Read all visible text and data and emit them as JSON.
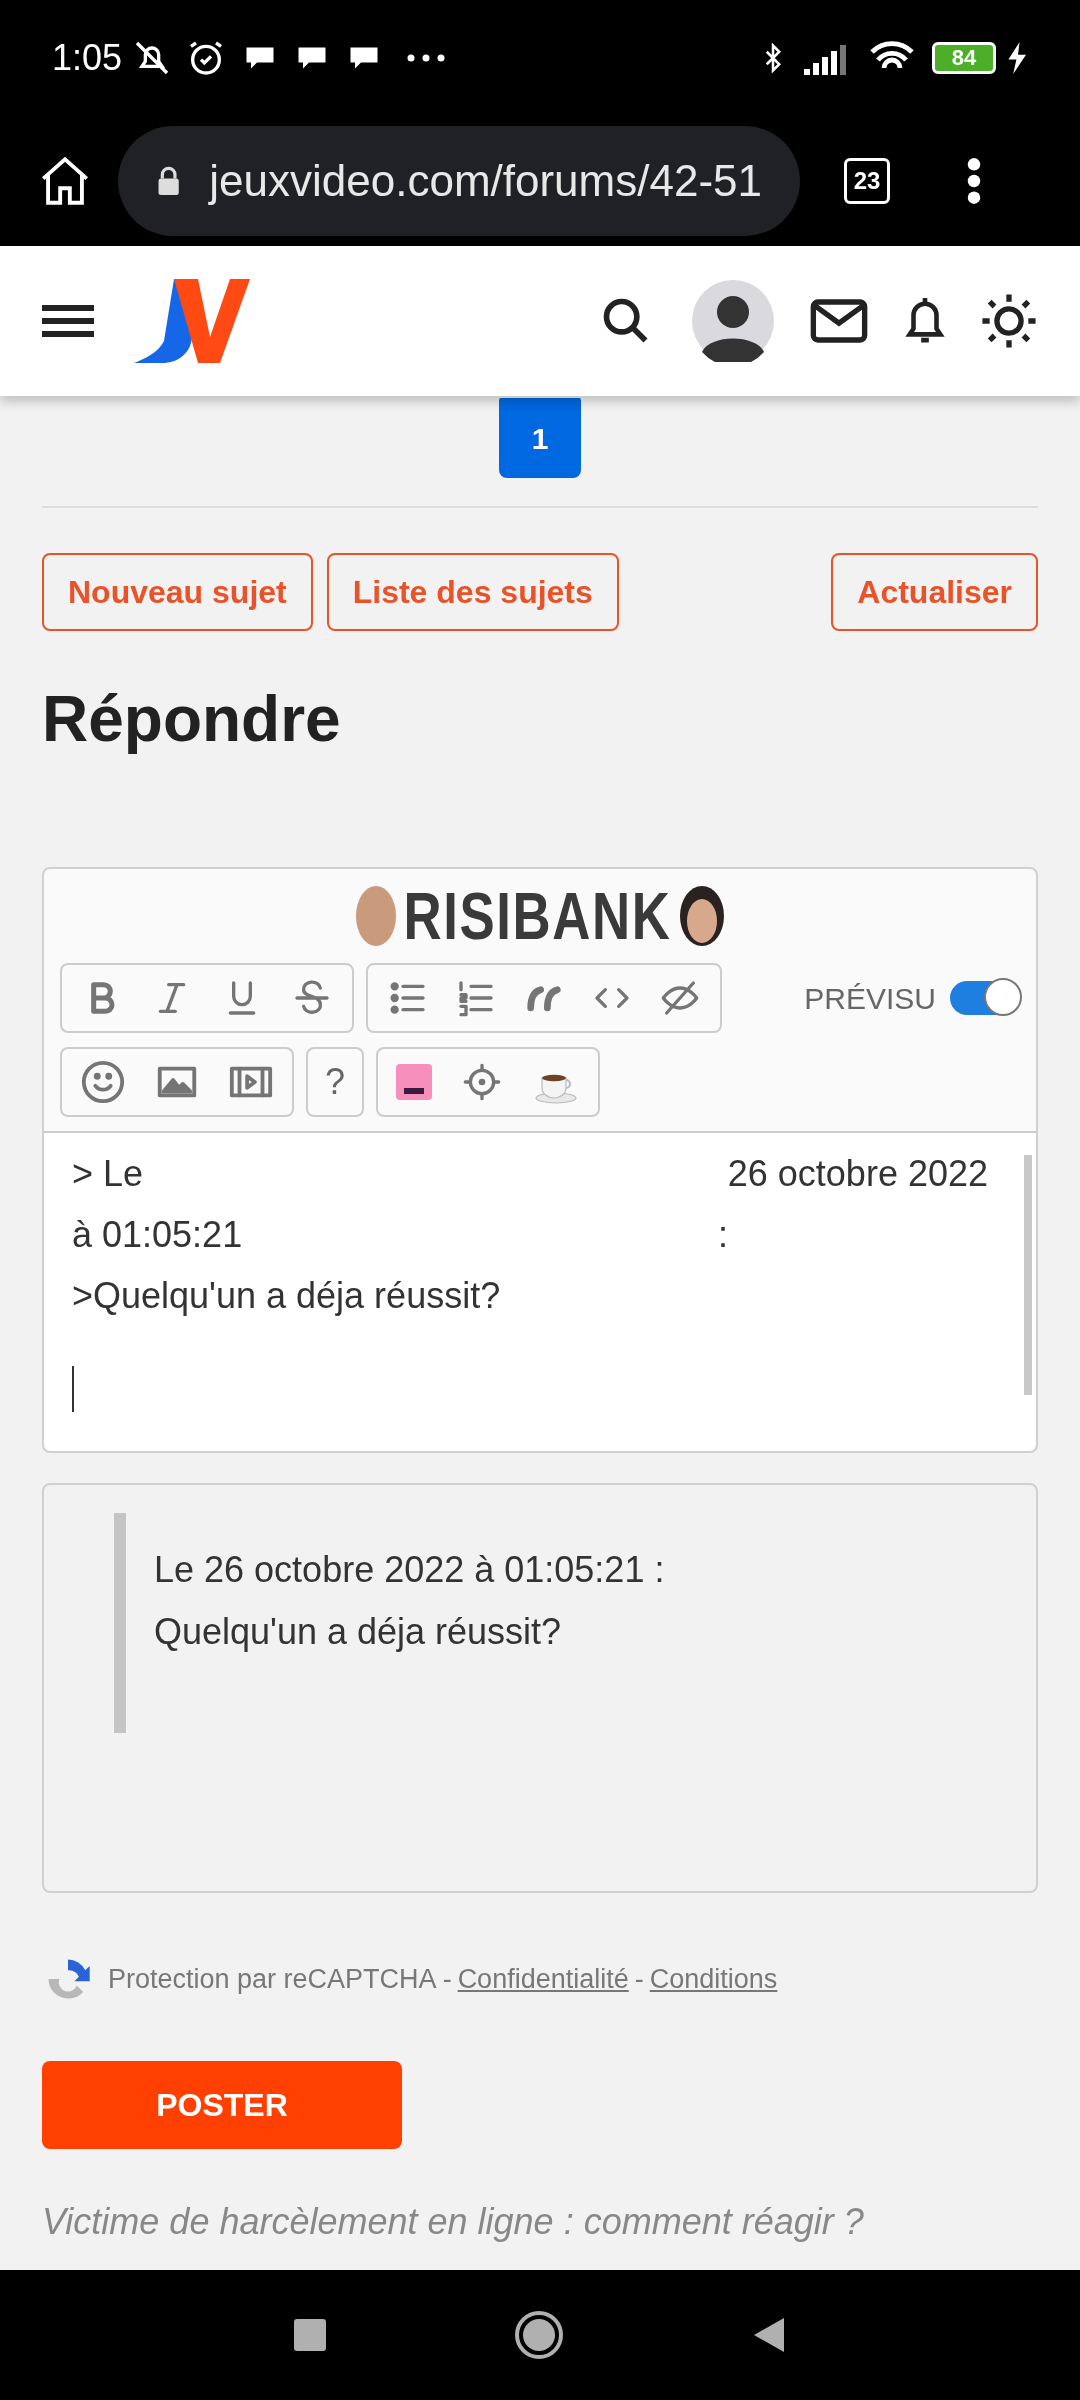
{
  "status_bar": {
    "time": "1:05",
    "battery": "84"
  },
  "browser": {
    "url": "jeuxvideo.com/forums/42-51",
    "tab_count": "23"
  },
  "pagination": [
    {
      "label": "1",
      "selected": true
    }
  ],
  "actions_left": [
    "Nouveau sujet",
    "Liste des sujets"
  ],
  "actions_right": [
    "Actualiser"
  ],
  "heading": "Répondre",
  "editor": {
    "brand": "RISIBANK",
    "help_label": "?",
    "preview_label": "PRÉVISU",
    "preview_on": true,
    "lines": [
      {
        "left": "> Le",
        "right": "26 octobre 2022"
      },
      {
        "left": "à 01:05:21",
        "right": ":"
      },
      {
        "left": ">Quelqu'un a déja réussit?"
      }
    ]
  },
  "preview": {
    "lines": [
      "Le 26 octobre 2022 à 01:05:21 :",
      "Quelqu'un a déja réussit?"
    ]
  },
  "recaptcha": {
    "text": "Protection par reCAPTCHA -",
    "links": [
      "Confidentialité",
      "Conditions"
    ],
    "separator": "-"
  },
  "submit": "POSTER",
  "footer_link": "Victime de harcèlement en ligne : comment réagir ?"
}
